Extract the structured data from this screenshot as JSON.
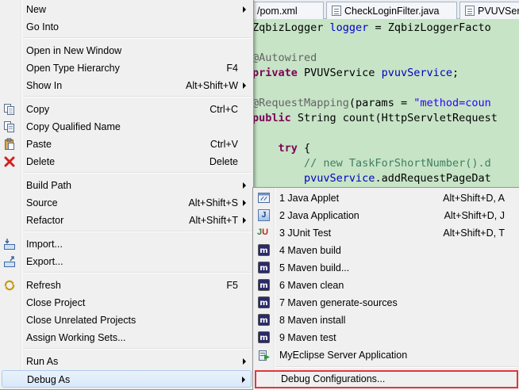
{
  "editor": {
    "tabs": [
      {
        "label": "/pom.xml"
      },
      {
        "label": "CheckLoginFilter.java"
      },
      {
        "label": "PVUVSer"
      }
    ],
    "lines": [
      {
        "parts": [
          {
            "t": "ZqbizLogger ",
            "c": ""
          },
          {
            "t": "logger",
            "c": "fld"
          },
          {
            "t": " = ZqbizLoggerFacto",
            "c": ""
          }
        ]
      },
      {
        "parts": []
      },
      {
        "parts": [
          {
            "t": "@Autowired",
            "c": "ann"
          }
        ]
      },
      {
        "parts": [
          {
            "t": "private",
            "c": "kw"
          },
          {
            "t": " PVUVService ",
            "c": ""
          },
          {
            "t": "pvuvService",
            "c": "fld"
          },
          {
            "t": ";",
            "c": ""
          }
        ]
      },
      {
        "parts": []
      },
      {
        "parts": [
          {
            "t": "@RequestMapping",
            "c": "ann"
          },
          {
            "t": "(params = ",
            "c": ""
          },
          {
            "t": "\"method=coun",
            "c": "str"
          }
        ]
      },
      {
        "parts": [
          {
            "t": "public",
            "c": "kw"
          },
          {
            "t": " String count(HttpServletRequest",
            "c": ""
          }
        ]
      },
      {
        "parts": []
      },
      {
        "parts": [
          {
            "t": "    ",
            "c": ""
          },
          {
            "t": "try",
            "c": "kw"
          },
          {
            "t": " {",
            "c": ""
          }
        ]
      },
      {
        "parts": [
          {
            "t": "        ",
            "c": ""
          },
          {
            "t": "// new TaskForShortNumber().d",
            "c": "cmt"
          }
        ]
      },
      {
        "parts": [
          {
            "t": "        ",
            "c": ""
          },
          {
            "t": "pvuvService",
            "c": "fld"
          },
          {
            "t": ".addRequestPageDat",
            "c": ""
          }
        ]
      }
    ]
  },
  "context_menu": {
    "items": [
      {
        "label": "New",
        "submenu": true
      },
      {
        "label": "Go Into"
      },
      {
        "label": "Open in New Window"
      },
      {
        "label": "Open Type Hierarchy",
        "accel": "F4"
      },
      {
        "label": "Show In",
        "accel": "Alt+Shift+W",
        "submenu": true
      },
      {
        "label": "Copy",
        "accel": "Ctrl+C",
        "icon": "copy-icon"
      },
      {
        "label": "Copy Qualified Name",
        "icon": "copy-qualified-name-icon"
      },
      {
        "label": "Paste",
        "accel": "Ctrl+V",
        "icon": "paste-icon"
      },
      {
        "label": "Delete",
        "accel": "Delete",
        "icon": "delete-icon"
      },
      {
        "label": "Build Path",
        "submenu": true
      },
      {
        "label": "Source",
        "accel": "Alt+Shift+S",
        "submenu": true
      },
      {
        "label": "Refactor",
        "accel": "Alt+Shift+T",
        "submenu": true
      },
      {
        "label": "Import...",
        "icon": "import-icon"
      },
      {
        "label": "Export...",
        "icon": "export-icon"
      },
      {
        "label": "Refresh",
        "accel": "F5",
        "icon": "refresh-icon"
      },
      {
        "label": "Close Project"
      },
      {
        "label": "Close Unrelated Projects"
      },
      {
        "label": "Assign Working Sets..."
      },
      {
        "label": "Run As",
        "submenu": true
      },
      {
        "label": "Debug As",
        "submenu": true
      }
    ]
  },
  "debug_as_submenu": {
    "items": [
      {
        "label": "1 Java Applet",
        "accel": "Alt+Shift+D, A",
        "icon": "java-applet-icon"
      },
      {
        "label": "2 Java Application",
        "accel": "Alt+Shift+D, J",
        "icon": "java-application-icon"
      },
      {
        "label": "3 JUnit Test",
        "accel": "Alt+Shift+D, T",
        "icon": "junit-icon"
      },
      {
        "label": "4 Maven build",
        "icon": "maven-icon"
      },
      {
        "label": "5 Maven build...",
        "icon": "maven-icon"
      },
      {
        "label": "6 Maven clean",
        "icon": "maven-icon"
      },
      {
        "label": "7 Maven generate-sources",
        "icon": "maven-icon"
      },
      {
        "label": "8 Maven install",
        "icon": "maven-icon"
      },
      {
        "label": "9 Maven test",
        "icon": "maven-icon"
      },
      {
        "label": "MyEclipse Server Application",
        "icon": "server-application-icon"
      },
      {
        "label": "Debug Configurations..."
      }
    ],
    "icon_letters": {
      "maven": "m",
      "java_application": "J",
      "junit_j": "J",
      "junit_u": "U"
    }
  },
  "colors": {
    "highlight_border": "#e0373c",
    "editor_background": "#c7e4c7",
    "menu_background": "#f0f0f0"
  }
}
